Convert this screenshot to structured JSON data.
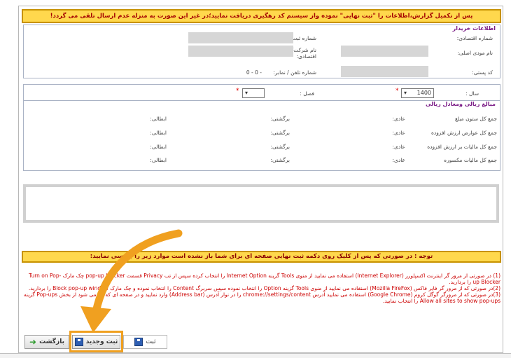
{
  "warning_top": "پس از تکمیل گزارش،اطلاعات را \"ثبت نهایی\" نموده واز سیستم کد رهگیری دریافت نمایید؛در غیر این صورت به منزله عدم ارسال تلقی می گردد!",
  "buyer": {
    "title": "اطلاعات خریدار",
    "economic_code_label": "شماره اقتصادی:",
    "registration_label": "شماره ثبت:",
    "taxpayer_name_label": "نام مودی اصلی:",
    "company_name_label": "نام شرکت/بنگاه اقتصادی:",
    "postal_code_label": "کد پستی:",
    "phone_label": "شماره تلفن / نمابر:",
    "phone_value": "0 - 0 -"
  },
  "period": {
    "year_label": "سال :",
    "year_value": "1400",
    "season_label": "فصل :",
    "season_value": "",
    "required_mark": "*"
  },
  "amounts": {
    "title": "مبالغ ریالی ومعادل ریالی",
    "rows": [
      {
        "label": "جمع کل ستون مبلغ",
        "normal": "عادی:",
        "returned": "برگشتی:",
        "cancelled": "ابطالی:"
      },
      {
        "label": "جمع کل عوارض ارزش افزوده",
        "normal": "عادی:",
        "returned": "برگشتی:",
        "cancelled": "ابطالی:"
      },
      {
        "label": "جمع کل مالیات بر ارزش افزوده",
        "normal": "عادی:",
        "returned": "برگشتی:",
        "cancelled": "ابطالی:"
      },
      {
        "label": "جمع کل مالیات مکسوره",
        "normal": "عادی:",
        "returned": "برگشتی:",
        "cancelled": "ابطالی:"
      }
    ]
  },
  "warning_mid": "توجه : در صورتی که پس از کلیک روی دکمه ثبت نهایی صفحه ای برای شما باز نشده است موارد زیر را بررسی نمایید:",
  "instructions": [
    "(1) در صورتی از مرور گر اینترنت اکسپلورر (Internet Explorer) استفاده می نمایید از منوی Tools گزینه Internet Option را انتخاب کرده سپس از تب Privacy قسمت pop-up blocker چک مارک Turn on Pop-up Blocker را بردارید.",
    "(2)در صورتی که از مرور گر فایر فاکس (Mozilla FireFox) استفاده می نمایید از منوی Tools گزینه Option را انتخاب نموده سپس سربرگ Content را انتخاب نموده و چک مارک Block pop-up window را بردارید.",
    "(3)در صورتی که از مرورگر گوگل کروم (Google Chrome) استفاده می نمایید آدرس chrome://settings/content را در نوار آدرس (Address bar) وارد نمایید و در صفحه ای که باز می شود از بخش Pop-ups گزینه Allow all sites to show pop-ups را انتخاب نمایید."
  ],
  "buttons": {
    "back": "بازگشت",
    "save_new": "ثبت وجدید",
    "save": "ثبت"
  },
  "colors": {
    "warning_bg": "#ffd84d",
    "warning_text": "#a40000",
    "highlight": "#f0a020",
    "section_title": "#7a1b86"
  }
}
